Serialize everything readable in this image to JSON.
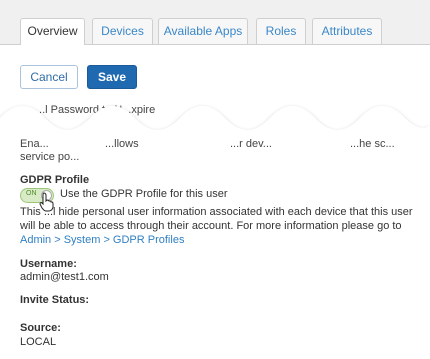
{
  "tabs": [
    {
      "label": "Overview",
      "active": true
    },
    {
      "label": "Devices",
      "active": false
    },
    {
      "label": "Available Apps",
      "active": false
    },
    {
      "label": "Roles",
      "active": false
    },
    {
      "label": "Attributes",
      "active": false
    }
  ],
  "actions": {
    "cancel_label": "Cancel",
    "save_label": "Save"
  },
  "fragments": {
    "line1": "...l Password to N...xpire",
    "line2a": "Ena...",
    "line2b": "...llows",
    "line2c": "...r dev...",
    "line2d": "...he sc...",
    "line3": "service po..."
  },
  "gdpr": {
    "heading": "GDPR Profile",
    "toggle_state": "ON",
    "toggle_label": "Use the GDPR Profile for this user",
    "desc_start": "This ...l hide personal user information associated with each device that this user will be able to access through their account. For more information please go to",
    "link_text": "Admin > System > GDPR Profiles"
  },
  "fields": {
    "username_label": "Username:",
    "username_value": "admin@test1.com",
    "invite_label": "Invite Status:",
    "source_label": "Source:",
    "source_value": "LOCAL"
  },
  "colors": {
    "primary": "#1f69b1",
    "link": "#2f7fc4",
    "toggle_on": "#d8ebc6"
  }
}
